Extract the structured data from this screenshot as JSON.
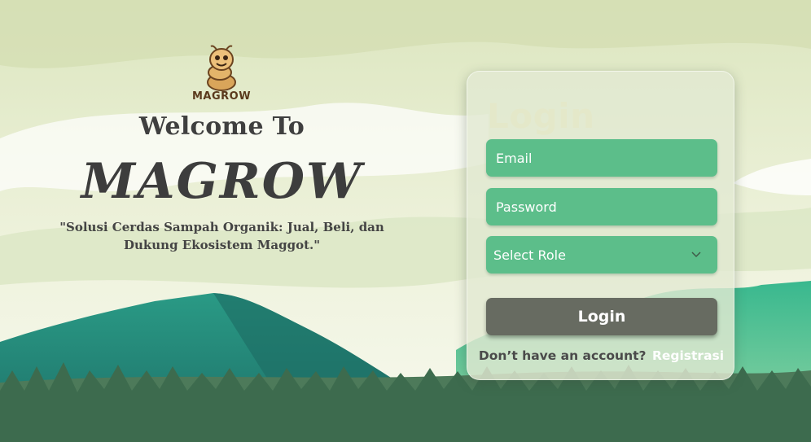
{
  "brand": {
    "logo_text": "MAGROW",
    "welcome": "Welcome To",
    "title": "MAGROW",
    "tagline": "\"Solusi Cerdas Sampah Organik: Jual, Beli, dan Dukung Ekosistem Maggot.\""
  },
  "login": {
    "heading": "Login",
    "email_placeholder": "Email",
    "password_placeholder": "Password",
    "role_selected": "Select Role",
    "submit_label": "Login",
    "signup_prompt": "Don’t have an account?",
    "signup_link": "Registrasi"
  },
  "icons": {
    "mascot": "maggot-mascot-icon",
    "dropdown": "chevron-down-icon"
  },
  "colors": {
    "field_bg": "#5cbe8a",
    "button_bg": "#676b61",
    "mountain": "#1f8a7a",
    "forest": "#3d6b4e",
    "title_text": "#3d3d3d"
  }
}
